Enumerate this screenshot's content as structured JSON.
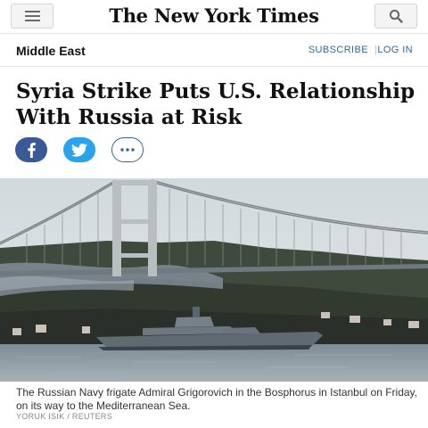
{
  "header": {
    "logo_text": "The New York Times",
    "menu_icon": "hamburger-menu-icon",
    "search_icon": "search-icon"
  },
  "section": {
    "name": "Middle East",
    "subscribe_label": "SUBSCRIBE",
    "separator": "|",
    "login_label": "LOG IN",
    "link_color": "#326891"
  },
  "article": {
    "headline": "Syria Strike Puts U.S. Relationship With Russia at Risk"
  },
  "share": {
    "facebook_icon": "facebook-icon",
    "facebook_color": "#3b5998",
    "twitter_icon": "twitter-icon",
    "twitter_color": "#2aa3ef",
    "more_icon": "more-options-icon"
  },
  "photo": {
    "caption": "The Russian Navy frigate Admiral Grigorovich in the Bosphorus in Istanbul on Friday, on its way to the Mediterranean Sea.",
    "credit": "YORUK ISIK / REUTERS"
  }
}
